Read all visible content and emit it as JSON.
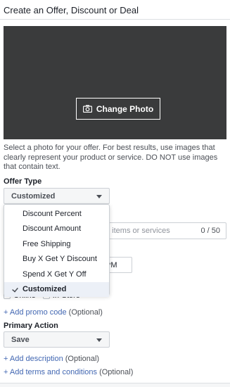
{
  "header": {
    "title": "Create an Offer, Discount or Deal"
  },
  "photo": {
    "change_label": "Change Photo",
    "icon": "camera-icon"
  },
  "help_text": "Select a photo for your offer. For best results, use images that clearly represent your product or service. DO NOT use images that contain text.",
  "offer_type": {
    "label": "Offer Type",
    "selected": "Customized",
    "options": [
      {
        "label": "Discount Percent",
        "selected": false
      },
      {
        "label": "Discount Amount",
        "selected": false
      },
      {
        "label": "Free Shipping",
        "selected": false
      },
      {
        "label": "Buy X Get Y Discount",
        "selected": false
      },
      {
        "label": "Spend X Get Y Off",
        "selected": false
      },
      {
        "label": "Customized",
        "selected": true
      }
    ]
  },
  "details_input": {
    "placeholder_visible": "d items or services",
    "counter": "0 / 50"
  },
  "time_field": {
    "value_visible": "PM"
  },
  "where": {
    "online": "Online",
    "in_store": "In-Store"
  },
  "links": {
    "promo_code": "+ Add promo code",
    "description": "+ Add description",
    "terms": "+ Add terms and conditions",
    "optional": "(Optional)"
  },
  "primary_action": {
    "label": "Primary Action",
    "selected": "Save"
  },
  "colors": {
    "link": "#4267b2",
    "photo_bg": "#3a3b3c",
    "selected_bg": "#ecf0f7"
  }
}
